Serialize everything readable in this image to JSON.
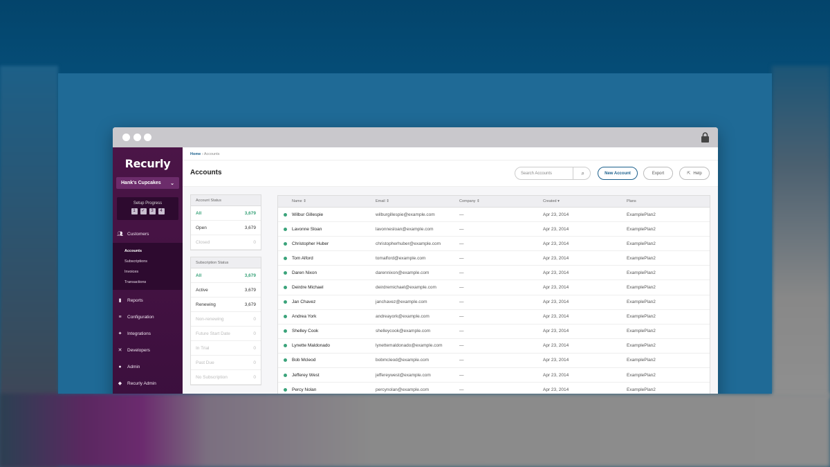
{
  "app": {
    "logo": "Recurly",
    "site": "Hank's Cupcakes"
  },
  "setup": {
    "label": "Setup Progress",
    "steps": [
      "1",
      "✓",
      "3",
      "4"
    ]
  },
  "nav": {
    "customers": "Customers",
    "sub": [
      "Accounts",
      "Subscriptions",
      "Invoices",
      "Transactions"
    ],
    "reports": "Reports",
    "configuration": "Configuration",
    "integrations": "Integrations",
    "developers": "Developers",
    "admin": "Admin",
    "recurly_admin": "Recurly Admin"
  },
  "breadcrumb": {
    "home": "Home",
    "sep": "›",
    "current": "Accounts"
  },
  "header": {
    "title": "Accounts",
    "search_placeholder": "Search Accounts",
    "new_account": "New Account",
    "export": "Export",
    "help": "Help"
  },
  "account_status": {
    "title": "Account Status",
    "rows": [
      {
        "label": "All",
        "count": "3,679"
      },
      {
        "label": "Open",
        "count": "3,679"
      },
      {
        "label": "Closed",
        "count": "0"
      }
    ]
  },
  "subscription_status": {
    "title": "Subscription Status",
    "rows": [
      {
        "label": "All",
        "count": "3,679"
      },
      {
        "label": "Active",
        "count": "3,679"
      },
      {
        "label": "Renewing",
        "count": "3,679"
      },
      {
        "label": "Non-renewing",
        "count": "0"
      },
      {
        "label": "Future Start Date",
        "count": "0"
      },
      {
        "label": "In Trial",
        "count": "0"
      },
      {
        "label": "Past Due",
        "count": "0"
      },
      {
        "label": "No Subscription",
        "count": "0"
      }
    ]
  },
  "table": {
    "columns": [
      "Name ⇕",
      "Email ⇕",
      "Company ⇕",
      "Created ▾",
      "Plans"
    ],
    "rows": [
      {
        "name": "Wilbur Gillespie",
        "email": "wilburgillespie@example.com",
        "company": "—",
        "created": "Apr 23, 2014",
        "plan": "ExamplePlan2"
      },
      {
        "name": "Lavonne Sloan",
        "email": "lavonnesloan@example.com",
        "company": "—",
        "created": "Apr 23, 2014",
        "plan": "ExamplePlan2"
      },
      {
        "name": "Christopher Huber",
        "email": "christopherhuber@example.com",
        "company": "—",
        "created": "Apr 23, 2014",
        "plan": "ExamplePlan2"
      },
      {
        "name": "Tom Alford",
        "email": "tomalford@example.com",
        "company": "—",
        "created": "Apr 23, 2014",
        "plan": "ExamplePlan2"
      },
      {
        "name": "Daren Nixon",
        "email": "darennixon@example.com",
        "company": "—",
        "created": "Apr 23, 2014",
        "plan": "ExamplePlan2"
      },
      {
        "name": "Deirdre Michael",
        "email": "deirdremichael@example.com",
        "company": "—",
        "created": "Apr 23, 2014",
        "plan": "ExamplePlan2"
      },
      {
        "name": "Jan Chavez",
        "email": "janchavez@example.com",
        "company": "—",
        "created": "Apr 23, 2014",
        "plan": "ExamplePlan2"
      },
      {
        "name": "Andrea York",
        "email": "andreayork@example.com",
        "company": "—",
        "created": "Apr 23, 2014",
        "plan": "ExamplePlan2"
      },
      {
        "name": "Shelley Cook",
        "email": "shelleycook@example.com",
        "company": "—",
        "created": "Apr 23, 2014",
        "plan": "ExamplePlan2"
      },
      {
        "name": "Lynette Maldonado",
        "email": "lynettemaldonado@example.com",
        "company": "—",
        "created": "Apr 23, 2014",
        "plan": "ExamplePlan2"
      },
      {
        "name": "Bob Mcleod",
        "email": "bobmcleod@example.com",
        "company": "—",
        "created": "Apr 23, 2014",
        "plan": "ExamplePlan2"
      },
      {
        "name": "Jefferey West",
        "email": "jeffereywest@example.com",
        "company": "—",
        "created": "Apr 23, 2014",
        "plan": "ExamplePlan2"
      },
      {
        "name": "Percy Nolan",
        "email": "percynolan@example.com",
        "company": "—",
        "created": "Apr 23, 2014",
        "plan": "ExamplePlan2"
      }
    ]
  }
}
